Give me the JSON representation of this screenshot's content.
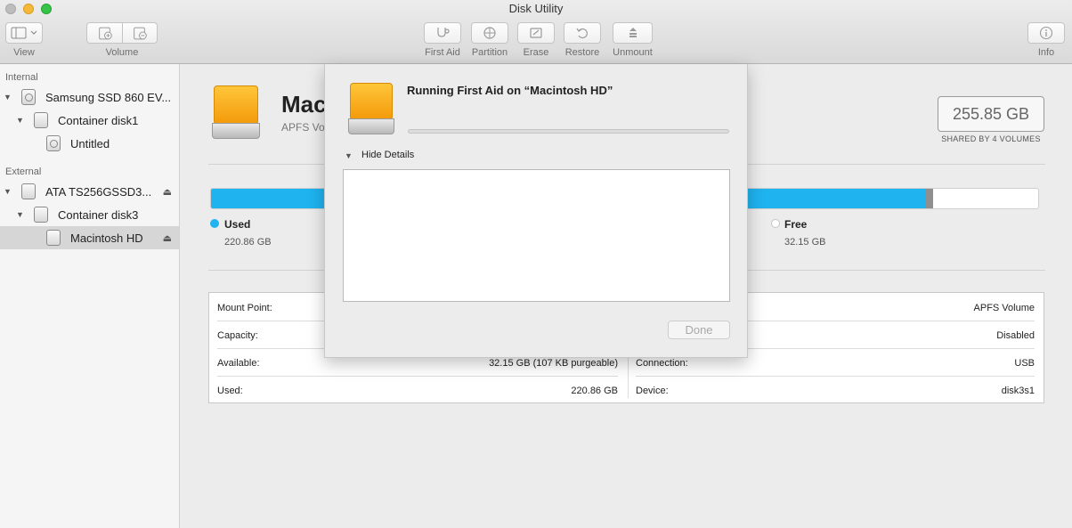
{
  "window": {
    "title": "Disk Utility"
  },
  "toolbar": {
    "view_label": "View",
    "volume_label": "Volume",
    "first_aid_label": "First Aid",
    "partition_label": "Partition",
    "erase_label": "Erase",
    "restore_label": "Restore",
    "unmount_label": "Unmount",
    "info_label": "Info"
  },
  "sidebar": {
    "internal_header": "Internal",
    "external_header": "External",
    "items": [
      {
        "label": "Samsung SSD 860 EV..."
      },
      {
        "label": "Container disk1"
      },
      {
        "label": "Untitled"
      },
      {
        "label": "ATA TS256GSSD3..."
      },
      {
        "label": "Container disk3"
      },
      {
        "label": "Macintosh HD"
      }
    ],
    "eject_glyph": "⏏"
  },
  "volume": {
    "name_visible": "Mac",
    "subtitle_visible": "APFS Vo",
    "capacity": "255.85 GB",
    "shared_note": "SHARED BY 4 VOLUMES"
  },
  "usage": {
    "used_label": "Used",
    "used_value": "220.86 GB",
    "free_label": "Free",
    "free_value": "32.15 GB",
    "used_fraction": 0.863,
    "purgeable_fraction": 0.01,
    "used_color": "#1fb3f0",
    "free_color": "#ffffff"
  },
  "info": {
    "left": [
      {
        "key": "Mount Point:",
        "value": ""
      },
      {
        "key": "Capacity:",
        "value": ""
      },
      {
        "key": "Available:",
        "value": "32.15 GB (107 KB purgeable)"
      },
      {
        "key": "Used:",
        "value": "220.86 GB"
      }
    ],
    "right": [
      {
        "key": "",
        "value": "APFS Volume"
      },
      {
        "key": "",
        "value": "Disabled"
      },
      {
        "key": "Connection:",
        "value": "USB"
      },
      {
        "key": "Device:",
        "value": "disk3s1"
      }
    ]
  },
  "sheet": {
    "title": "Running First Aid on “Macintosh HD”",
    "progress": 0.0,
    "details_label": "Hide Details",
    "details_glyph": "▼",
    "log_text": "",
    "done_label": "Done"
  },
  "icons": {
    "disclosure_open": "▼"
  }
}
